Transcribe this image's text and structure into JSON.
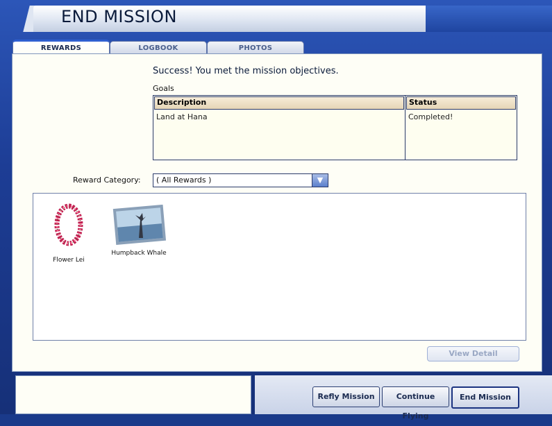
{
  "window": {
    "title": "END MISSION"
  },
  "tabs": [
    {
      "label": "REWARDS",
      "active": true
    },
    {
      "label": "LOGBOOK",
      "active": false
    },
    {
      "label": "PHOTOS",
      "active": false
    }
  ],
  "rewards_tab": {
    "result_message": "Success! You met the mission objectives.",
    "goals_label": "Goals",
    "goals_table": {
      "columns": [
        "Description",
        "Status"
      ],
      "rows": [
        {
          "description": "Land at Hana",
          "status": "Completed!"
        }
      ]
    },
    "reward_category": {
      "label": "Reward Category:",
      "selected": "( All Rewards )"
    },
    "rewards": [
      {
        "name": "Flower Lei",
        "icon": "flower-lei-icon"
      },
      {
        "name": "Humpback Whale",
        "icon": "humpback-whale-photo"
      }
    ],
    "view_detail_button": "View Detail"
  },
  "footer": {
    "buttons": [
      "Refly Mission",
      "Continue Flying",
      "End Mission"
    ]
  },
  "colors": {
    "frame": "#1d3d95",
    "panel": "#fefef6",
    "header_cell": "#e6d6b6"
  }
}
